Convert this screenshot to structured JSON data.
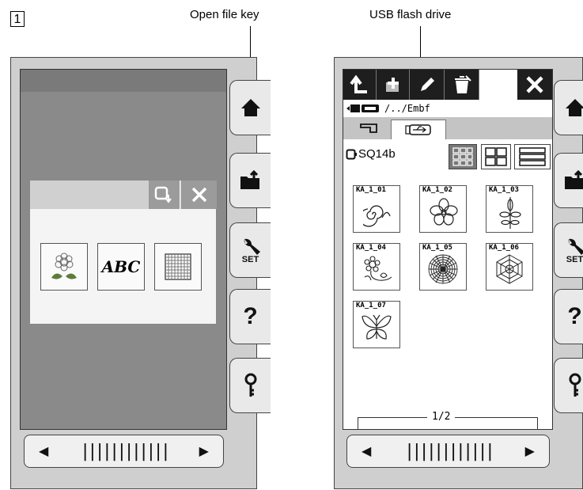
{
  "step": {
    "number": "1"
  },
  "callouts": {
    "open_file_key": "Open file key",
    "usb_flash_drive": "USB flash drive"
  },
  "left_screen": {
    "sidebar": [
      {
        "icon": "home-icon"
      },
      {
        "icon": "open-folder-icon"
      },
      {
        "icon": "wrench-icon",
        "caption": "SET"
      },
      {
        "icon": "help-icon",
        "glyph": "?"
      },
      {
        "icon": "key-icon"
      }
    ],
    "dialog": {
      "choices": [
        {
          "icon": "flower-embroidery-icon"
        },
        {
          "icon": "monogram-icon",
          "text": "ABC"
        },
        {
          "icon": "grid-icon"
        }
      ]
    }
  },
  "right_screen": {
    "path": "/../Embf",
    "file_name": "SQ14b",
    "page_indicator": "1/2",
    "designs": [
      {
        "label": "KA_1_01",
        "icon": "spiral-design-icon"
      },
      {
        "label": "KA_1_02",
        "icon": "flower-design-icon"
      },
      {
        "label": "KA_1_03",
        "icon": "vine-design-icon"
      },
      {
        "label": "KA_1_04",
        "icon": "floral-corner-design-icon"
      },
      {
        "label": "KA_1_05",
        "icon": "circle-design-icon"
      },
      {
        "label": "KA_1_06",
        "icon": "hexagon-design-icon"
      },
      {
        "label": "KA_1_07",
        "icon": "butterfly-design-icon"
      }
    ]
  }
}
